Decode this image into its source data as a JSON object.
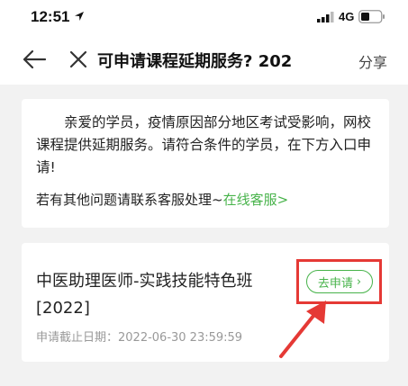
{
  "status": {
    "time": "12:51",
    "network": "4G"
  },
  "nav": {
    "title": "可申请课程延期服务? 202",
    "share": "分享"
  },
  "notice": {
    "text": "亲爱的学员，疫情原因部分地区考试受影响，网校课程提供延期服务。请符合条件的学员，在下方入口申请!",
    "contact_prefix": "若有其他问题请联系客服处理~",
    "contact_link": "在线客服>"
  },
  "course": {
    "title": "中医助理医师-实践技能特色班[2022]",
    "deadline": "申请截止日期：2022-06-30 23:59:59",
    "apply_label": "去申请",
    "apply_chevron": "›"
  },
  "colors": {
    "accent": "#47b34a",
    "highlight": "#e53935"
  }
}
